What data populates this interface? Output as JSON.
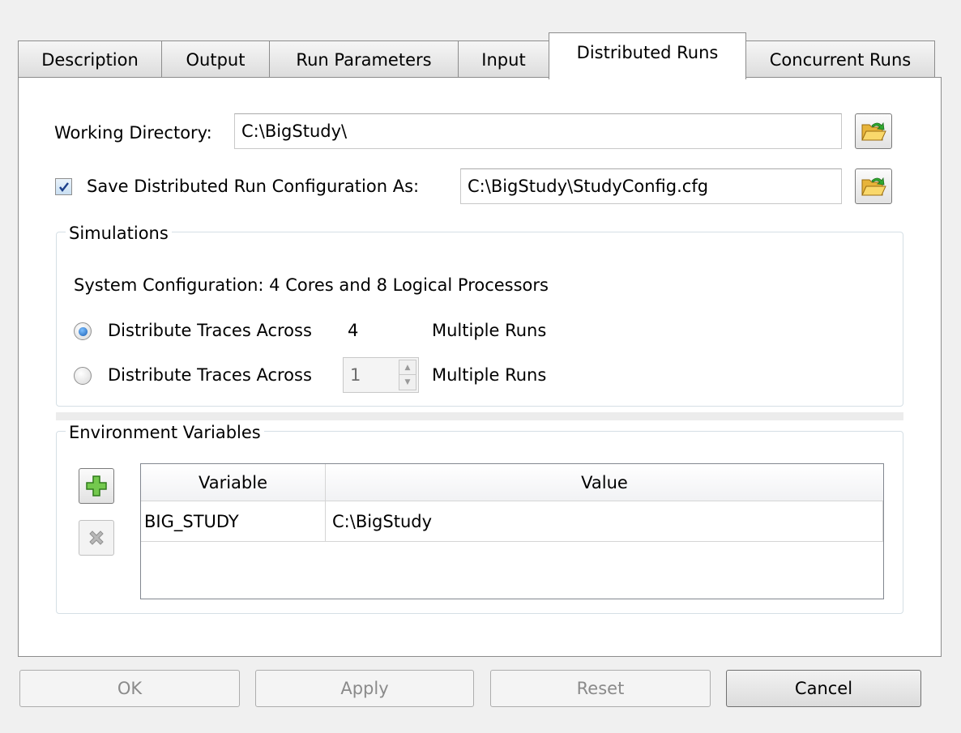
{
  "tabs": [
    {
      "label": "Description"
    },
    {
      "label": "Output"
    },
    {
      "label": "Run Parameters"
    },
    {
      "label": "Input"
    },
    {
      "label": "Distributed Runs",
      "active": true
    },
    {
      "label": "Concurrent Runs"
    }
  ],
  "working_directory": {
    "label": "Working Directory:",
    "value": "C:\\BigStudy\\",
    "browse_icon": "folder-open-icon"
  },
  "save_config": {
    "checked": true,
    "label": "Save Distributed Run Configuration As:",
    "value": "C:\\BigStudy\\StudyConfig.cfg",
    "browse_icon": "folder-open-icon"
  },
  "simulations": {
    "title": "Simulations",
    "system_config": "System Configuration:  4 Cores and  8 Logical Processors",
    "option1": {
      "label": "Distribute Traces Across",
      "value": "4",
      "suffix": "Multiple Runs",
      "selected": true
    },
    "option2": {
      "label": "Distribute Traces Across",
      "value": "1",
      "suffix": "Multiple Runs",
      "selected": false
    }
  },
  "environment": {
    "title": "Environment Variables",
    "add_icon": "plus-icon",
    "remove_icon": "delete-x-icon",
    "columns": [
      "Variable",
      "Value"
    ],
    "rows": [
      {
        "variable": "BIG_STUDY",
        "value": "C:\\BigStudy"
      }
    ]
  },
  "buttons": {
    "ok": "OK",
    "apply": "Apply",
    "reset": "Reset",
    "cancel": "Cancel"
  },
  "colors": {
    "folder": "#f5c542",
    "arrow": "#2fa82f",
    "plus": "#3fae2a",
    "radio_selected": "#1a5fb4"
  }
}
